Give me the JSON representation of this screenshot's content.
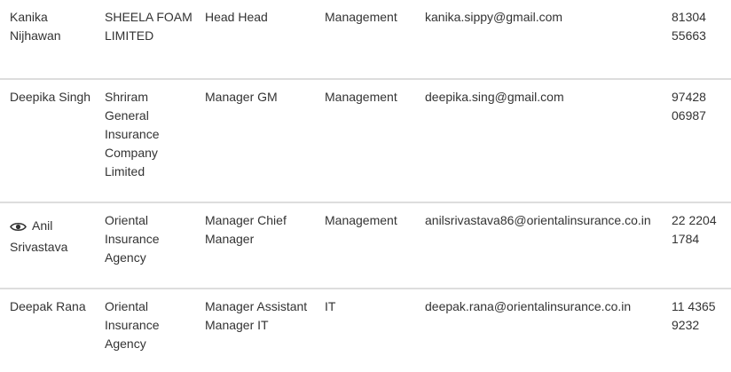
{
  "rows": [
    {
      "name": "Kanika Nijhawan",
      "company": "SHEELA FOAM LIMITED",
      "designation": "Head Head",
      "department": "Management",
      "email": "kanika.sippy@gmail.com",
      "phone_line1": "81304",
      "phone_line2": "55663",
      "icon": null
    },
    {
      "name": "Deepika Singh",
      "company": "Shriram General Insurance Company Limited",
      "designation": "Manager GM",
      "department": "Management",
      "email": "deepika.sing@gmail.com",
      "phone_line1": "97428",
      "phone_line2": "06987",
      "icon": null
    },
    {
      "name": "Anil Srivastava",
      "company": "Oriental Insurance Agency",
      "designation": "Manager Chief Manager",
      "department": "Management",
      "email": "anilsrivastava86@orientalinsurance.co.in",
      "phone_line1": "22 2204",
      "phone_line2": "1784",
      "icon": "eye-icon"
    },
    {
      "name": "Deepak Rana",
      "company": "Oriental Insurance Agency",
      "designation": "Manager Assistant Manager IT",
      "department": "IT",
      "email": "deepak.rana@orientalinsurance.co.in",
      "phone_line1": "11 4365",
      "phone_line2": "9232",
      "icon": null
    }
  ],
  "colors": {
    "text": "#333333",
    "divider": "#dddddd",
    "background": "#ffffff"
  }
}
